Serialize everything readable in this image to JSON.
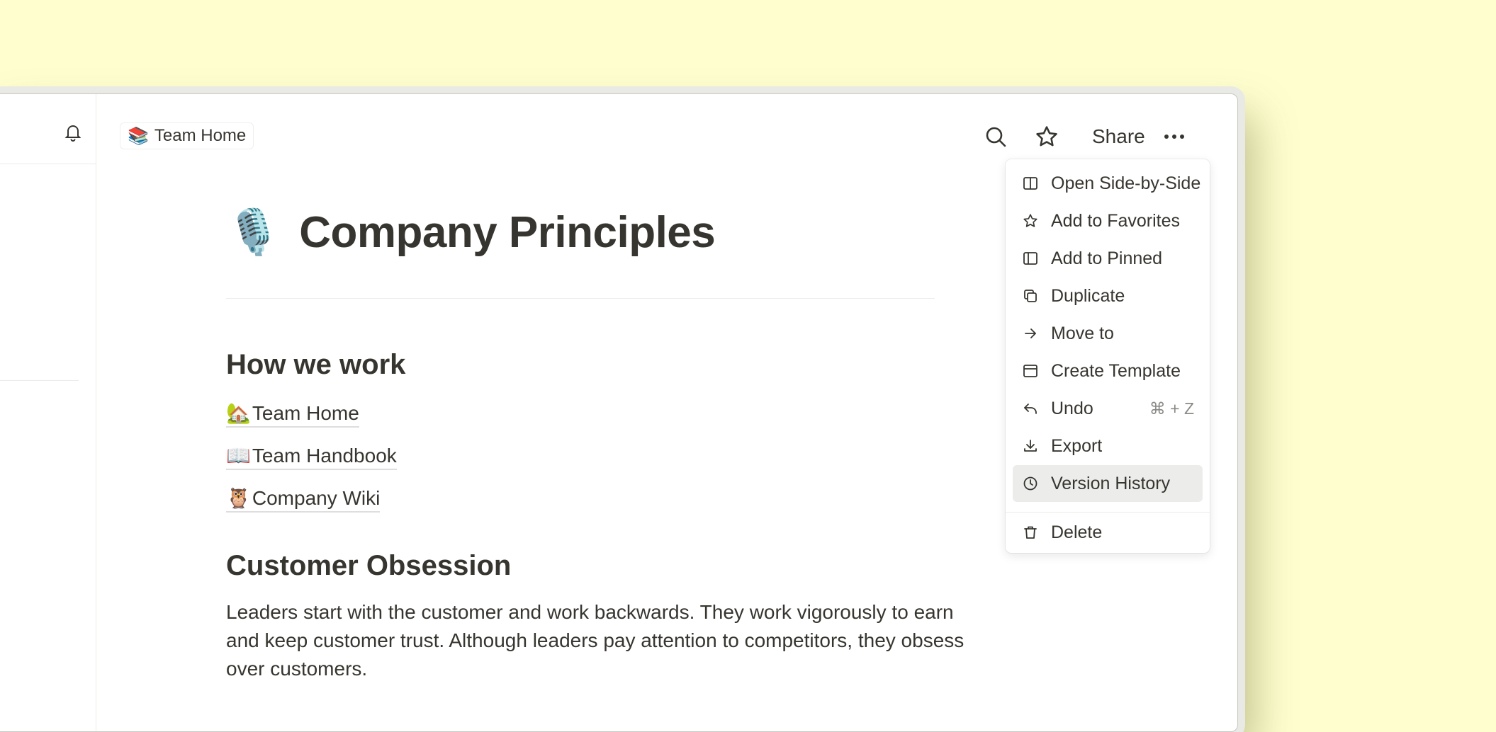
{
  "colors": {
    "background": "#fefecf",
    "window": "#ffffff",
    "text": "#37352f",
    "muted": "#8a8a86",
    "active_item": "#ececeb"
  },
  "header": {
    "breadcrumb": {
      "emoji": "📚",
      "label": "Team Home"
    },
    "share_label": "Share",
    "icons": [
      "bell-icon",
      "search-icon",
      "star-icon",
      "more-icon"
    ]
  },
  "page": {
    "emoji": "🎙️",
    "title": "Company Principles",
    "section1": {
      "heading": "How we work",
      "links": [
        {
          "emoji": "🏡",
          "label": "Team Home"
        },
        {
          "emoji": "📖",
          "label": "Team Handbook"
        },
        {
          "emoji": "🦉",
          "label": "Company Wiki"
        }
      ]
    },
    "section2": {
      "heading": "Customer Obsession",
      "paragraph": "Leaders start with the customer and work backwards. They work vigorously to earn and keep customer trust. Although leaders pay attention to competitors, they obsess over customers."
    }
  },
  "menu": {
    "items": [
      {
        "label": "Open Side-by-Side",
        "icon": "side-by-side-icon"
      },
      {
        "label": "Add to Favorites",
        "icon": "star-icon"
      },
      {
        "label": "Add to Pinned",
        "icon": "pin-panel-icon"
      },
      {
        "label": "Duplicate",
        "icon": "duplicate-icon"
      },
      {
        "label": "Move to",
        "icon": "arrow-right-icon"
      },
      {
        "label": "Create Template",
        "icon": "template-icon"
      },
      {
        "label": "Undo",
        "icon": "undo-icon",
        "shortcut": "⌘ + Z"
      },
      {
        "label": "Export",
        "icon": "download-icon"
      },
      {
        "label": "Version History",
        "icon": "clock-icon",
        "active": true
      },
      {
        "label": "Delete",
        "icon": "trash-icon"
      }
    ]
  }
}
